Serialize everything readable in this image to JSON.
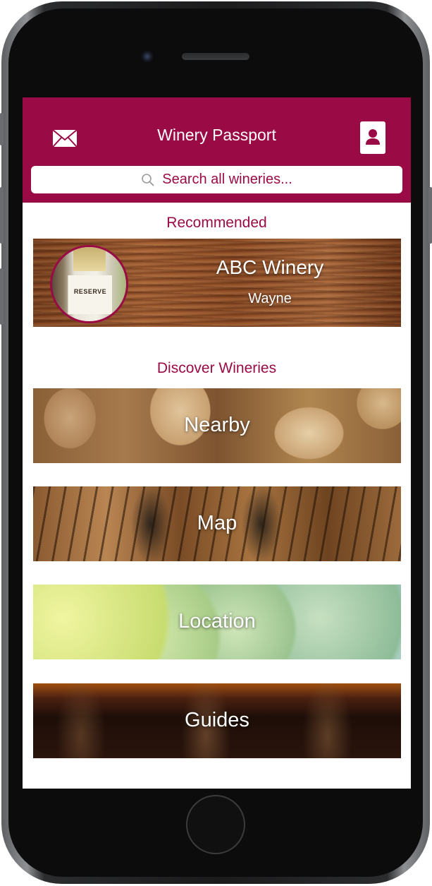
{
  "navbar": {
    "title": "Winery Passport",
    "search_placeholder": "Search all wineries...",
    "mail_icon": "envelope-icon",
    "profile_icon": "person-icon",
    "accent_color": "#9a0b46"
  },
  "recommended": {
    "heading": "Recommended",
    "winery_name": "ABC Winery",
    "winery_location": "Wayne",
    "thumbnail_label": "RESERVE"
  },
  "discover": {
    "heading": "Discover Wineries",
    "tiles": [
      {
        "label": "Nearby"
      },
      {
        "label": "Map"
      },
      {
        "label": "Location"
      },
      {
        "label": "Guides"
      }
    ]
  }
}
